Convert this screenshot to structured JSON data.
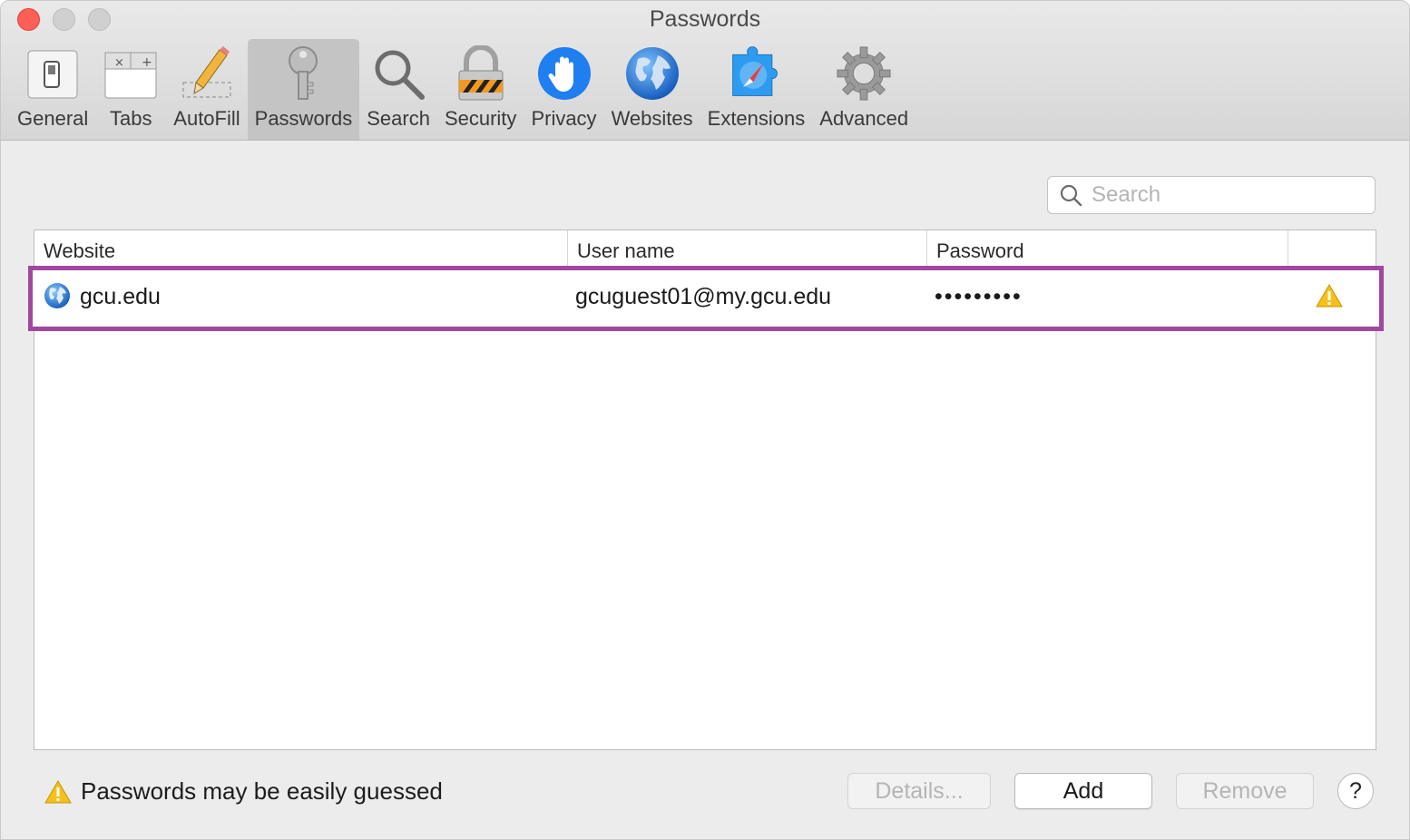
{
  "window": {
    "title": "Passwords"
  },
  "toolbar": {
    "tabs": [
      {
        "label": "General",
        "icon": "switch-icon"
      },
      {
        "label": "Tabs",
        "icon": "tabs-icon"
      },
      {
        "label": "AutoFill",
        "icon": "pencil-icon"
      },
      {
        "label": "Passwords",
        "icon": "key-icon",
        "active": true
      },
      {
        "label": "Search",
        "icon": "magnifier-icon"
      },
      {
        "label": "Security",
        "icon": "lock-icon"
      },
      {
        "label": "Privacy",
        "icon": "hand-icon"
      },
      {
        "label": "Websites",
        "icon": "globe-icon"
      },
      {
        "label": "Extensions",
        "icon": "puzzle-icon"
      },
      {
        "label": "Advanced",
        "icon": "gear-icon"
      }
    ]
  },
  "search": {
    "placeholder": "Search",
    "value": ""
  },
  "table": {
    "columns": [
      "Website",
      "User name",
      "Password"
    ],
    "rows": [
      {
        "website": "gcu.edu",
        "username": "gcuguest01@my.gcu.edu",
        "password": "•••••••••",
        "warning": true
      }
    ]
  },
  "footer": {
    "warning_text": "Passwords may be easily guessed",
    "details_label": "Details...",
    "add_label": "Add",
    "remove_label": "Remove",
    "help_label": "?"
  },
  "colors": {
    "highlight": "#a048a0",
    "close": "#fe5f57",
    "privacy_blue": "#1f7ef0",
    "warning": "#f5c01a"
  }
}
